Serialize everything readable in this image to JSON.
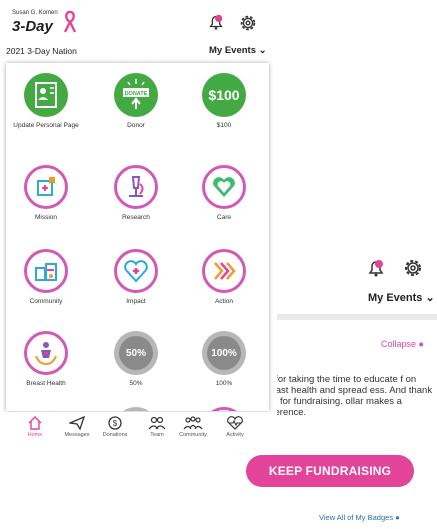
{
  "background": {
    "my_events": "My Events",
    "collapse": "Collapse",
    "heading": "e",
    "body": "ou for taking the time to educate f on breast health and spread ess. And thank you for fundraising. ollar makes a difference.",
    "keep_fundraising": "KEEP FUNDRAISING",
    "view_all": "View All of My Badges"
  },
  "header": {
    "logo_small": "Susan G. Komen",
    "logo_big": "3-Day",
    "event_name": "2021 3-Day Nation",
    "my_events": "My Events"
  },
  "badges": [
    {
      "label": "Update Personal Page",
      "kind": "green",
      "icon": "personal-page-icon"
    },
    {
      "label": "Donor",
      "kind": "green",
      "icon": "donate-icon",
      "text": "DONATE"
    },
    {
      "label": "$100",
      "kind": "green",
      "icon": "dollar-icon",
      "text": "$100"
    },
    {
      "label": "Mission",
      "kind": "ring",
      "icon": "mission-icon"
    },
    {
      "label": "Research",
      "kind": "ring",
      "icon": "microscope-icon"
    },
    {
      "label": "Care",
      "kind": "ring",
      "icon": "heart-icon"
    },
    {
      "label": "Community",
      "kind": "ring",
      "icon": "community-icon"
    },
    {
      "label": "Impact",
      "kind": "ring",
      "icon": "impact-heart-icon"
    },
    {
      "label": "Action",
      "kind": "ring",
      "icon": "action-arrows-icon"
    },
    {
      "label": "Breast Health",
      "kind": "ring",
      "icon": "breast-health-icon"
    },
    {
      "label": "50%",
      "kind": "grey",
      "text": "50%"
    },
    {
      "label": "100%",
      "kind": "grey",
      "text": "100%"
    }
  ],
  "nav": [
    {
      "label": "Home"
    },
    {
      "label": "Messages"
    },
    {
      "label": "Donations"
    },
    {
      "label": "Team"
    },
    {
      "label": "Community"
    },
    {
      "label": "Activity"
    }
  ],
  "colors": {
    "pink": "#e2449a",
    "green": "#43a942",
    "ring": "#d05ab5"
  }
}
